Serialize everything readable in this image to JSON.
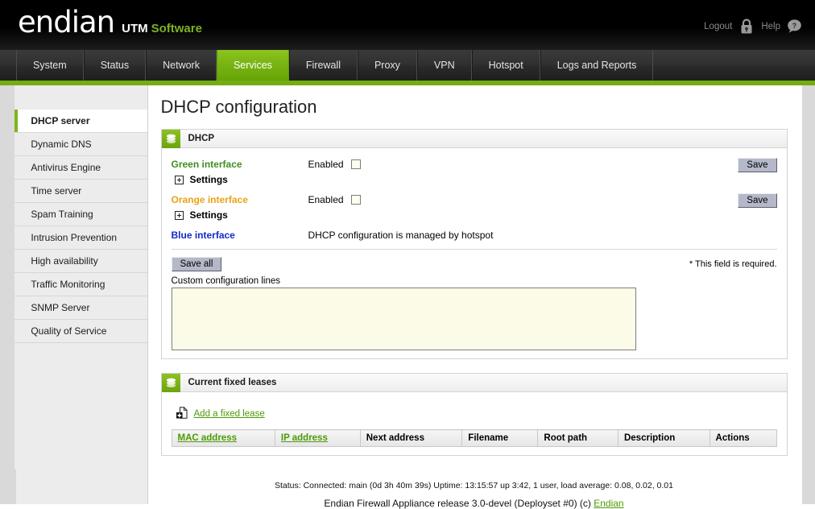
{
  "header": {
    "logo_main": "endian",
    "logo_utm": "UTM",
    "logo_software": "Software",
    "logout_label": "Logout",
    "logout_icon": "lock-icon",
    "help_label": "Help",
    "help_icon": "help-question-icon",
    "accent_green": "#7bb322"
  },
  "nav": {
    "tabs": [
      {
        "label": "System",
        "active": false
      },
      {
        "label": "Status",
        "active": false
      },
      {
        "label": "Network",
        "active": false
      },
      {
        "label": "Services",
        "active": true
      },
      {
        "label": "Firewall",
        "active": false
      },
      {
        "label": "Proxy",
        "active": false
      },
      {
        "label": "VPN",
        "active": false
      },
      {
        "label": "Hotspot",
        "active": false
      },
      {
        "label": "Logs and Reports",
        "active": false
      }
    ]
  },
  "sidebar": {
    "items": [
      {
        "label": "DHCP server",
        "active": true
      },
      {
        "label": "Dynamic DNS",
        "active": false
      },
      {
        "label": "Antivirus Engine",
        "active": false
      },
      {
        "label": "Time server",
        "active": false
      },
      {
        "label": "Spam Training",
        "active": false
      },
      {
        "label": "Intrusion Prevention",
        "active": false
      },
      {
        "label": "High availability",
        "active": false
      },
      {
        "label": "Traffic Monitoring",
        "active": false
      },
      {
        "label": "SNMP Server",
        "active": false
      },
      {
        "label": "Quality of Service",
        "active": false
      }
    ]
  },
  "main": {
    "page_title": "DHCP configuration",
    "dhcp_panel": {
      "title": "DHCP",
      "icon": "layers-icon",
      "interfaces": [
        {
          "name": "Green interface",
          "color": "#3f8d1d",
          "enabled_label": "Enabled",
          "enabled": false,
          "save_label": "Save",
          "settings_label": "Settings",
          "has_settings": true,
          "note": ""
        },
        {
          "name": "Orange interface",
          "color": "#e8a317",
          "enabled_label": "Enabled",
          "enabled": false,
          "save_label": "Save",
          "settings_label": "Settings",
          "has_settings": true,
          "note": ""
        },
        {
          "name": "Blue interface",
          "color": "#1429c8",
          "enabled_label": "",
          "enabled": false,
          "save_label": "",
          "settings_label": "",
          "has_settings": false,
          "note": "DHCP configuration is managed by hotspot"
        }
      ],
      "save_all_label": "Save all",
      "required_note": "* This field is required.",
      "custom_config_label": "Custom configuration lines",
      "custom_config_value": "",
      "custom_config_placeholder": ""
    },
    "leases_panel": {
      "title": "Current fixed leases",
      "icon": "layers-icon",
      "add_link_label": "Add a fixed lease",
      "add_link_icon": "page-add-icon",
      "columns": [
        {
          "label": "MAC address",
          "sortable": true
        },
        {
          "label": "IP address",
          "sortable": true
        },
        {
          "label": "Next address",
          "sortable": false
        },
        {
          "label": "Filename",
          "sortable": false
        },
        {
          "label": "Root path",
          "sortable": false
        },
        {
          "label": "Description",
          "sortable": false
        },
        {
          "label": "Actions",
          "sortable": false
        }
      ],
      "rows": []
    }
  },
  "footer": {
    "status_line": "Status: Connected: main (0d 3h 40m 39s) Uptime: 13:15:57 up 3:42, 1 user, load average: 0.08, 0.02, 0.01",
    "release_prefix": "Endian Firewall Appliance release 3.0-devel (Deployset #0) (c) ",
    "release_link": "Endian"
  }
}
